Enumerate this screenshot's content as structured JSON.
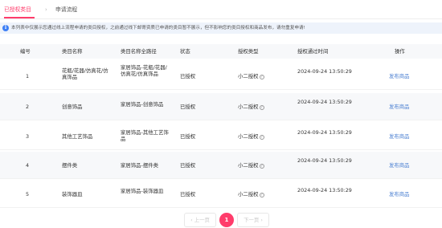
{
  "tabs": [
    {
      "label": "已授权类目",
      "active": true
    },
    {
      "label": "申请流程",
      "active": false
    }
  ],
  "tab_separator": "›",
  "notice": {
    "icon": "info-icon",
    "text": "本列表中仅展示您通过线上流程申请的类目授权，之前通过线下邮寄资质已申请的类目暂不展示，但不影响您的类目授权和商品发布，请勿重复申请!"
  },
  "table": {
    "columns": [
      "编号",
      "类目名称",
      "类目名称全路径",
      "状态",
      "授权类型",
      "授权通过时间",
      "操作"
    ],
    "rows": [
      {
        "index": "1",
        "name": "花瓶/花器/仿真花/仿真饰品",
        "path": "家居饰品-花瓶/花器/仿真花/仿真饰品",
        "status": "已授权",
        "type": "小二授权",
        "time": "2024-09-24 13:50:29",
        "action": "发布商品"
      },
      {
        "index": "2",
        "name": "创意饰品",
        "path": "家居饰品-创意饰品",
        "status": "已授权",
        "type": "小二授权",
        "time": "2024-09-24 13:50:29",
        "action": "发布商品"
      },
      {
        "index": "3",
        "name": "其他工艺饰品",
        "path": "家居饰品-其他工艺饰品",
        "status": "已授权",
        "type": "小二授权",
        "time": "2024-09-24 13:50:29",
        "action": "发布商品"
      },
      {
        "index": "4",
        "name": "摆件类",
        "path": "家居饰品-摆件类",
        "status": "已授权",
        "type": "小二授权",
        "time": "2024-09-24 13:50:29",
        "action": "发布商品"
      },
      {
        "index": "5",
        "name": "装饰器皿",
        "path": "家居饰品-装饰器皿",
        "status": "已授权",
        "type": "小二授权",
        "time": "2024-09-24 13:50:29",
        "action": "发布商品"
      }
    ]
  },
  "pagination": {
    "prev": "‹ 上一页",
    "current": "1",
    "next": "下一页 ›"
  },
  "help_icon_glyph": "?",
  "colors": {
    "accent": "#ff3c6b",
    "link": "#4a7fd1",
    "info": "#3d7ff5",
    "notice_bg": "#eef3fb",
    "header_bg": "#f7f8fa"
  }
}
